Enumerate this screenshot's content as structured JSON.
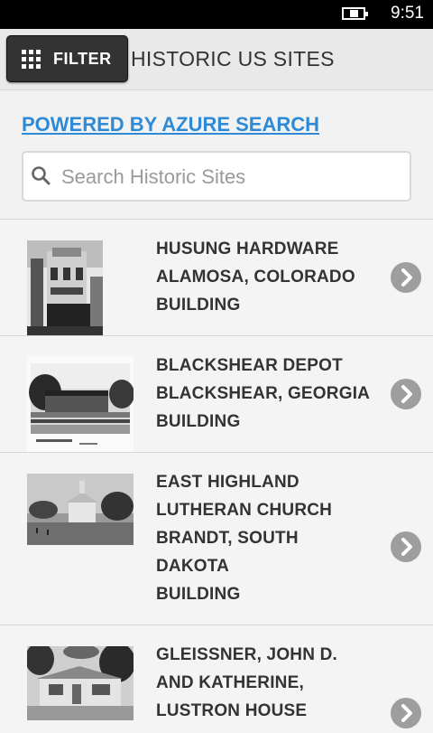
{
  "status": {
    "time": "9:51"
  },
  "header": {
    "filter_label": "FILTER",
    "title": "HISTORIC US SITES"
  },
  "powered_by": "POWERED BY AZURE SEARCH",
  "search": {
    "placeholder": "Search Historic Sites",
    "value": ""
  },
  "sites": [
    {
      "lines": [
        "HUSUNG HARDWARE",
        "ALAMOSA, COLORADO",
        "BUILDING"
      ]
    },
    {
      "lines": [
        "BLACKSHEAR DEPOT",
        "BLACKSHEAR, GEORGIA",
        "BUILDING"
      ]
    },
    {
      "lines": [
        "EAST HIGHLAND",
        "LUTHERAN CHURCH",
        "BRANDT, SOUTH",
        "DAKOTA",
        "BUILDING"
      ]
    },
    {
      "lines": [
        "GLEISSNER, JOHN D.",
        "AND KATHERINE,",
        "LUSTRON HOUSE"
      ]
    }
  ],
  "icons": {
    "filter": "grid-icon",
    "search": "search-icon",
    "row": "chevron-right-icon",
    "battery": "battery-charging-icon"
  }
}
